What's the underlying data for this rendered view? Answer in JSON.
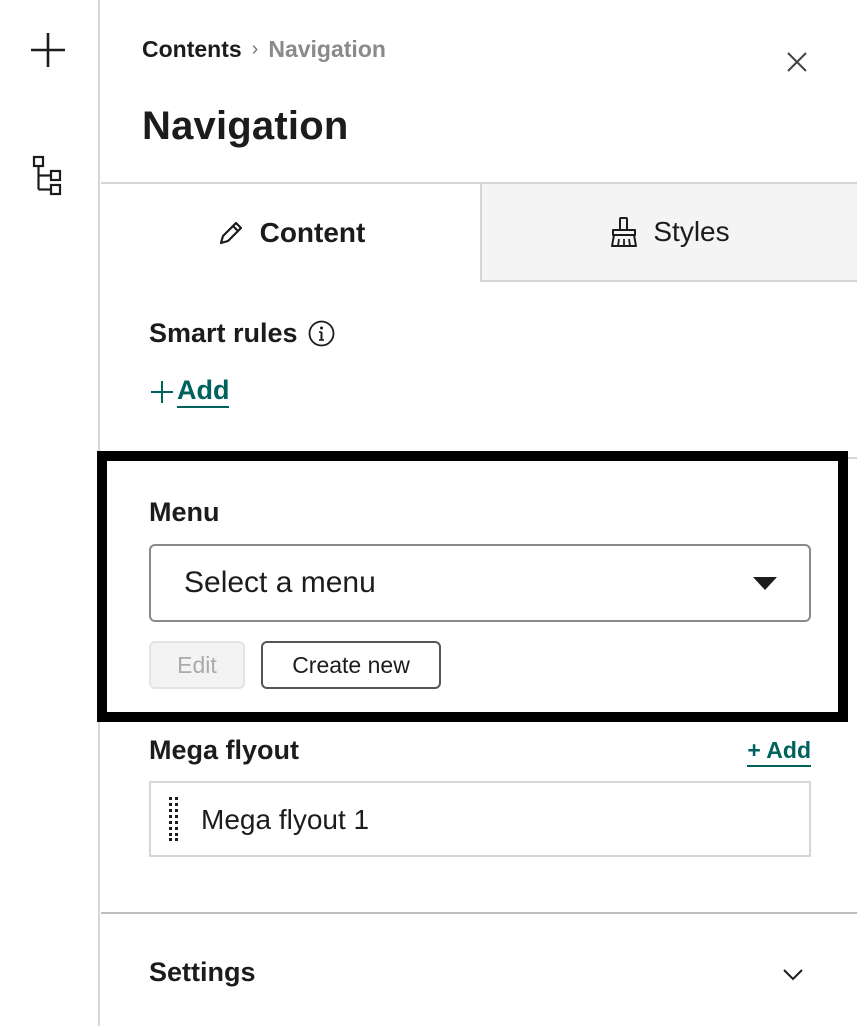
{
  "rail": {
    "items": [
      {
        "icon": "plus-icon",
        "label": ""
      },
      {
        "icon": "tree-structure-icon",
        "label": ""
      }
    ]
  },
  "header": {
    "breadcrumb": {
      "parent": "Contents",
      "separator": "›",
      "current": "Navigation"
    },
    "title": "Navigation",
    "close_icon": "close-icon"
  },
  "tabs": [
    {
      "label": "Content",
      "icon": "pencil-icon",
      "active": true
    },
    {
      "label": "Styles",
      "icon": "paintbrush-icon",
      "active": false
    }
  ],
  "smart_rules": {
    "label": "Smart rules",
    "info_icon": "info-icon",
    "add_symbol": "+",
    "add_label": "Add"
  },
  "menu": {
    "label": "Menu",
    "select_value": "Select a menu",
    "edit_label": "Edit",
    "create_label": "Create new"
  },
  "mega_flyout": {
    "label": "Mega flyout",
    "add_label": "+ Add",
    "items": [
      {
        "label": "Mega flyout 1"
      }
    ]
  },
  "settings": {
    "label": "Settings"
  },
  "colors": {
    "accent_link": "#00625c",
    "border": "#d6d6d6",
    "highlight": "#000000",
    "inactive_tab": "#f4f4f4"
  }
}
